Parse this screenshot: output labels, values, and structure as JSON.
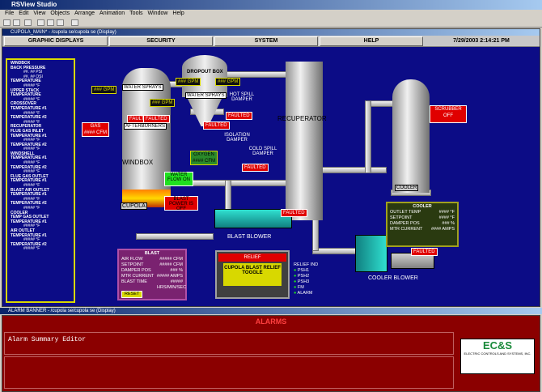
{
  "app": {
    "title": "RSView Studio"
  },
  "menu": [
    "File",
    "Edit",
    "View",
    "Objects",
    "Arrange",
    "Animation",
    "Tools",
    "Window",
    "Help"
  ],
  "display": {
    "title": "CUPOLA_MAIN* - /cupola se/cupola se (Display)"
  },
  "nav": {
    "graphic": "GRAPHIC DISPLAYS",
    "security": "SECURITY",
    "system": "SYSTEM",
    "help": "HELP",
    "datetime": "7/29/2003 2:14:21 PM"
  },
  "left_panel": [
    {
      "h": "WINDBOX",
      "v": ""
    },
    {
      "h": "BACK PRESSURE",
      "v": "##. ## PSI"
    },
    {
      "h": "",
      "v": "##. ## OSI"
    },
    {
      "h": "TEMPERATURE",
      "v": "##### °F"
    },
    {
      "h": "UPPER STACK",
      "v": ""
    },
    {
      "h": "TEMPERATURE",
      "v": "##### °F"
    },
    {
      "h": "CROSSOVER",
      "v": ""
    },
    {
      "h": "TEMPERATURE #1",
      "v": "##### °F"
    },
    {
      "h": "TEMPERATURE #2",
      "v": "##### °F"
    },
    {
      "h": "RECUPERATOR",
      "v": ""
    },
    {
      "h": "FLUE GAS INLET",
      "v": ""
    },
    {
      "h": "TEMPERATURE #1",
      "v": "##### °F"
    },
    {
      "h": "TEMPERATURE #2",
      "v": "##### °F"
    },
    {
      "h": "WINDSHELL",
      "v": ""
    },
    {
      "h": "TEMPERATURE #1",
      "v": "##### °F"
    },
    {
      "h": "TEMPERATURE #2",
      "v": "##### °F"
    },
    {
      "h": "FLUE GAS OUTLET",
      "v": ""
    },
    {
      "h": "TEMPERATURE #1",
      "v": "##### °F"
    },
    {
      "h": "BLAST AIR OUTLET",
      "v": ""
    },
    {
      "h": "TEMPERATURE #1",
      "v": "##### °F"
    },
    {
      "h": "TEMPERATURE #2",
      "v": "##### °F"
    },
    {
      "h": "COOLER",
      "v": ""
    },
    {
      "h": "TEMP GAS OUTLET",
      "v": ""
    },
    {
      "h": "TEMPERATURE #1",
      "v": "##### °F"
    },
    {
      "h": "AIR OUTLET",
      "v": ""
    },
    {
      "h": "TEMPERATURE #1",
      "v": "##### °F"
    },
    {
      "h": "TEMPERATURE #2",
      "v": "##### °F"
    }
  ],
  "process": {
    "water_sprays_1": "WATER SPRAYS",
    "water_sprays_2": "WATER SPRAYS",
    "dropout_box": "DROPOUT BOX",
    "gpm": "### GPM",
    "afterburners": "AFTERBURNERS",
    "gas": "GAS",
    "gas_cfm": "#### CFM",
    "windbox": "WINDBOX",
    "cupola": "CUPOLA",
    "hot_spill": "HOT SPILL DAMPER",
    "isolation": "ISOLATION DAMPER",
    "cold_spill": "COLD SPILL DAMPER",
    "recuperator": "RECUPERATOR",
    "oxygen": "OXYGEN",
    "oxygen_cfm": "#### CFM",
    "water_flow": "WATER FLOW ON",
    "blast_power": "BLAST POWER IS OFF",
    "blast_blower": "BLAST BLOWER",
    "cooler": "COOLER",
    "cooler_blower": "COOLER BLOWER",
    "scrubber": "SCRUBBER OFF",
    "faulted": "FAULTED"
  },
  "blast": {
    "title": "BLAST",
    "rows": [
      [
        "AIR FLOW",
        "##### CFM"
      ],
      [
        "SETPOINT",
        "##### CFM"
      ],
      [
        "DAMPER POS",
        "### %"
      ],
      [
        "MTR CURRENT",
        "##### AMPS"
      ],
      [
        "BLAST TIME",
        "#####"
      ]
    ],
    "sub": "HRS/MIN/SEC",
    "reset": "RESET"
  },
  "relief": {
    "label": "RELIEF",
    "toggle": "CUPOLA BLAST RELIEF TOGGLE",
    "ind_title": "RELIEF IND",
    "ind": [
      "PSH1",
      "PSH2",
      "PSH3",
      "FM",
      "ALARM"
    ]
  },
  "cooler_panel": {
    "title": "COOLER",
    "rows": [
      [
        "OUTLET TEMP",
        "#### °F"
      ],
      [
        "SETPOINT",
        "#### °F"
      ],
      [
        "DAMPER POS",
        "### %"
      ],
      [
        "MTR CURRENT",
        "#### AMPS"
      ]
    ]
  },
  "alarm": {
    "title": "ALARM BANNER - /cupola se/cupola se (Display)",
    "header": "ALARMS",
    "summary": "Alarm Summary Editor",
    "logo": "EC&S",
    "logo_sub": "ELECTRIC CONTROLS AND SYSTEMS, INC."
  },
  "colors": {
    "background": "#0c0c86",
    "fault": "#e00000",
    "panel_border": "#d8d800"
  }
}
